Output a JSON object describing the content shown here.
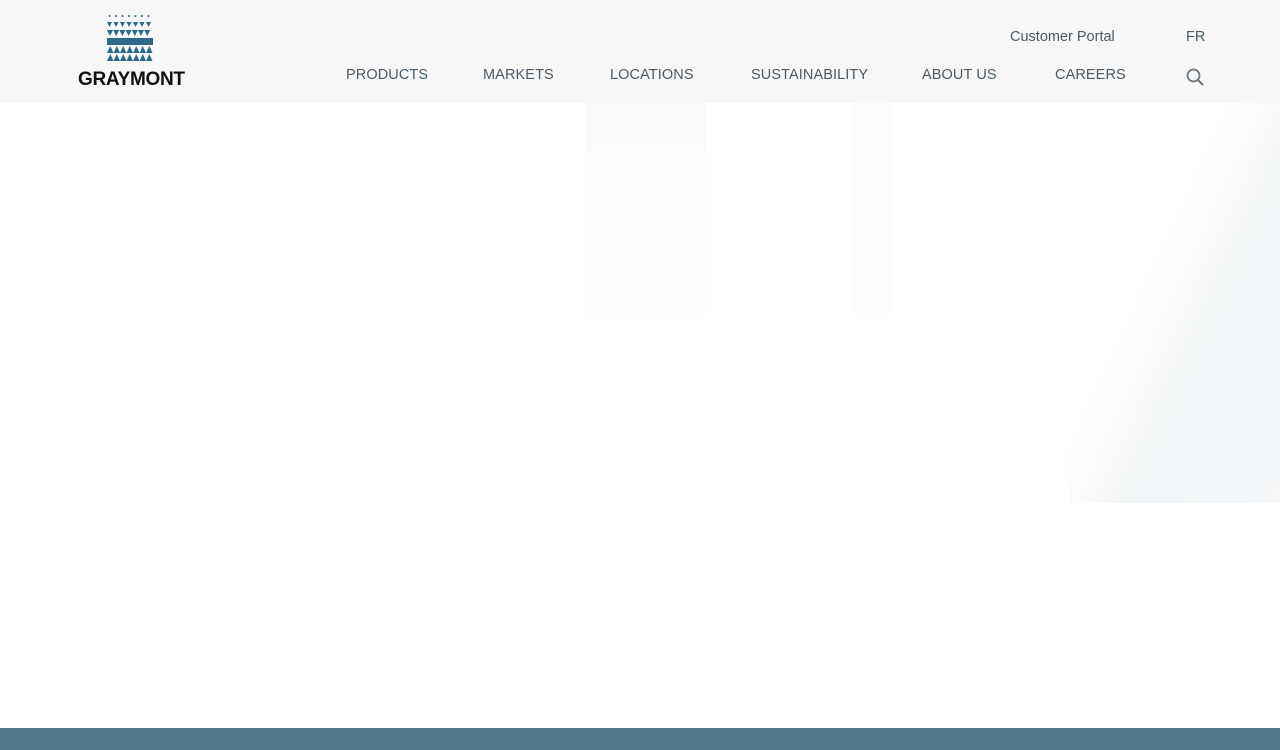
{
  "header": {
    "logo": {
      "text": "GRAYMONT",
      "brand_color": "#2c6a8c"
    },
    "utility": {
      "customer_portal": "Customer Portal",
      "language": "FR"
    },
    "nav": [
      {
        "label": "PRODUCTS"
      },
      {
        "label": "MARKETS"
      },
      {
        "label": "LOCATIONS"
      },
      {
        "label": "SUSTAINABILITY"
      },
      {
        "label": "ABOUT US"
      },
      {
        "label": "CAREERS"
      }
    ],
    "search_icon": "search-icon"
  },
  "colors": {
    "header_bg": "#f7f7f7",
    "nav_text": "#4a5a66",
    "footer_bar": "#50778b"
  }
}
